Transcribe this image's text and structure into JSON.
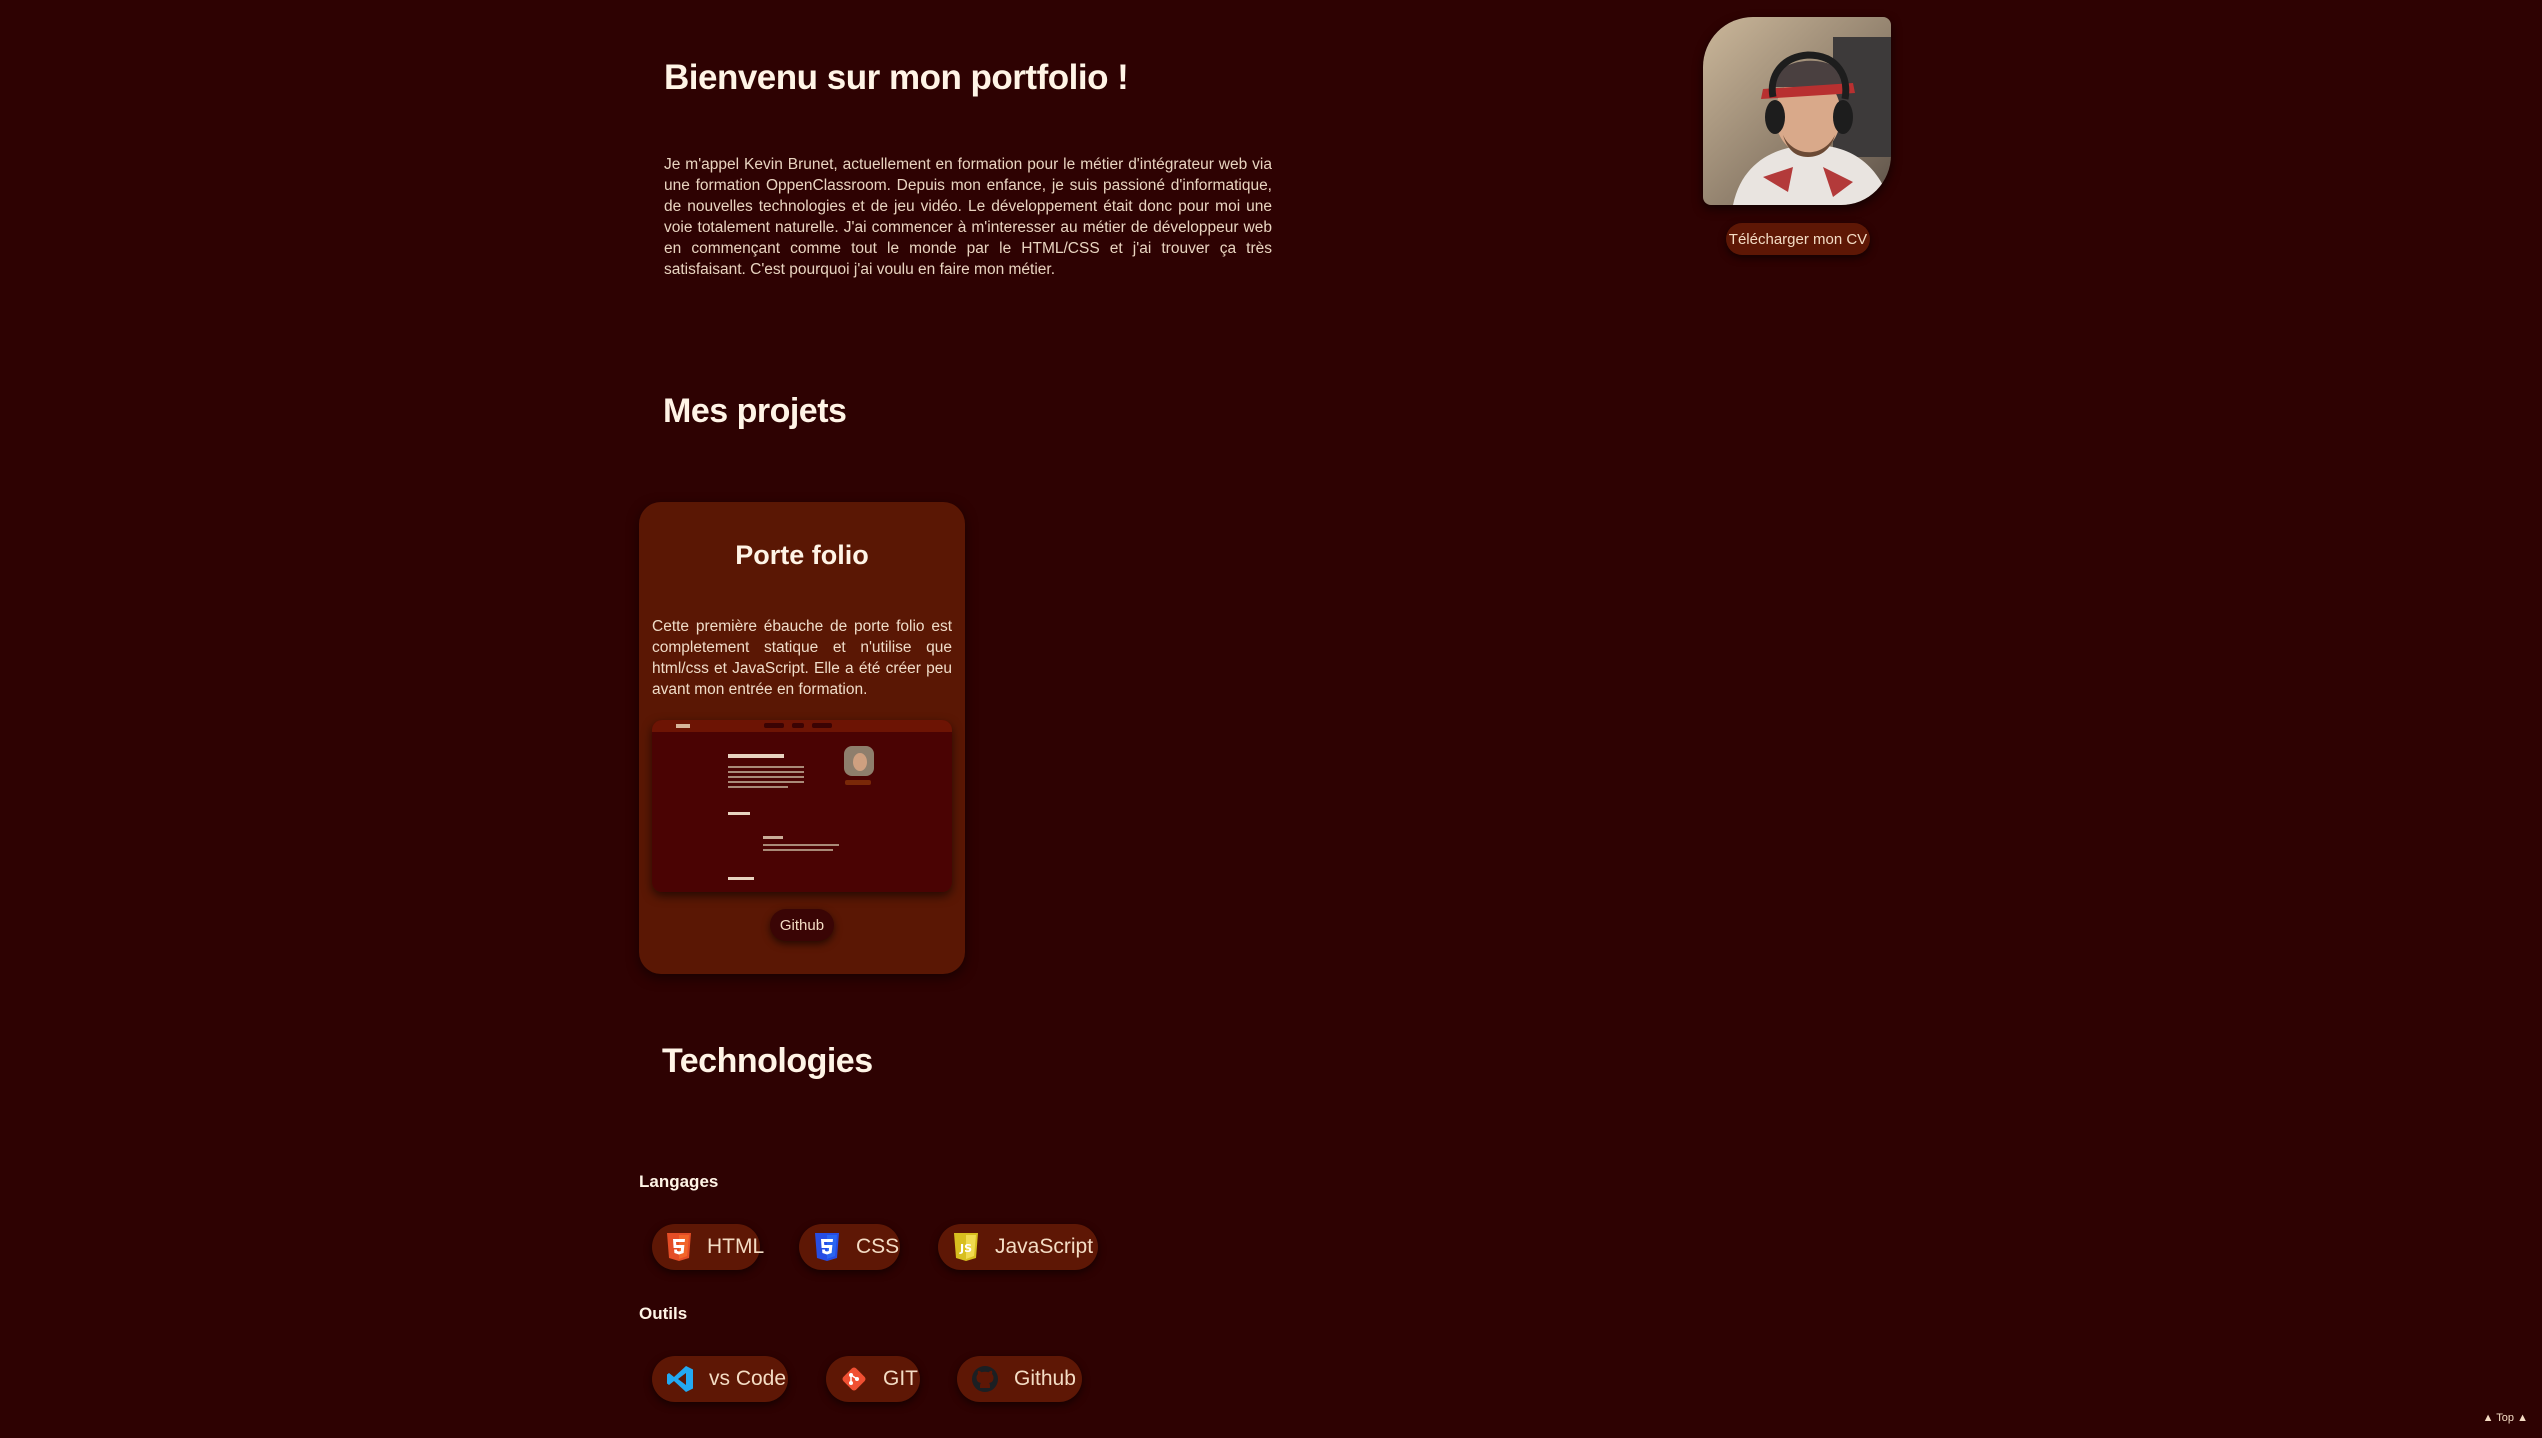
{
  "hero": {
    "title": "Bienvenu sur mon portfolio !",
    "intro": "Je m'appel Kevin Brunet, actuellement en formation pour le métier d'intégrateur web via une formation OppenClassroom. Depuis mon enfance, je suis passioné d'informatique, de nouvelles technologies et de jeu vidéo. Le développement était donc pour moi une voie totalement naturelle. J'ai commencer à m'interesser au métier de développeur web en commençant comme tout le monde par le HTML/CSS et j'ai trouver ça très satisfaisant. C'est pourquoi j'ai voulu en faire mon métier.",
    "cv_button": "Télécharger mon CV"
  },
  "projects": {
    "heading": "Mes projets",
    "items": [
      {
        "title": "Porte folio",
        "description": "Cette première ébauche de porte folio est completement statique et n'utilise que html/css et JavaScript. Elle a été créer peu avant mon entrée en formation.",
        "button": "Github"
      }
    ]
  },
  "technologies": {
    "heading": "Technologies",
    "languages": {
      "label": "Langages",
      "items": [
        {
          "name": "HTML",
          "icon": "html5-icon",
          "color": "#e44d26"
        },
        {
          "name": "CSS",
          "icon": "css3-icon",
          "color": "#264de4"
        },
        {
          "name": "JavaScript",
          "icon": "javascript-icon",
          "color": "#f0db4f"
        }
      ]
    },
    "tools": {
      "label": "Outils",
      "items": [
        {
          "name": "vs Code",
          "icon": "vscode-icon",
          "color": "#23a9f2"
        },
        {
          "name": "GIT",
          "icon": "git-icon",
          "color": "#f05033"
        },
        {
          "name": "Github",
          "icon": "github-icon",
          "color": "#1b1f23"
        }
      ]
    }
  },
  "footer": {
    "top_link": "▲ Top ▲"
  },
  "colors": {
    "background": "#2e0202",
    "card": "#5a1704",
    "button": "#5e1705"
  }
}
